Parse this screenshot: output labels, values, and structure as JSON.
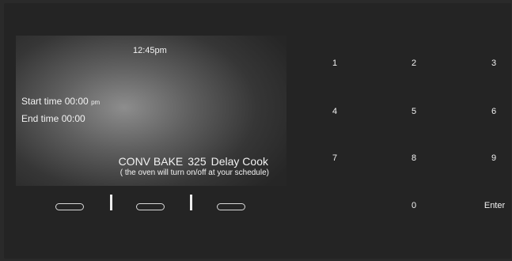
{
  "display": {
    "clock": "12:45pm",
    "start_label": "Start time",
    "start_value": "00:00",
    "start_ampm": "pm",
    "end_label": "End time",
    "end_value": "00:00",
    "mode": "CONV BAKE",
    "temperature": "325",
    "function": "Delay Cook",
    "note": "( the oven will turn on/off at your schedule)"
  },
  "keypad": {
    "k1": "1",
    "k2": "2",
    "k3": "3",
    "k4": "4",
    "k5": "5",
    "k6": "6",
    "k7": "7",
    "k8": "8",
    "k9": "9",
    "k0": "0",
    "enter": "Enter"
  }
}
